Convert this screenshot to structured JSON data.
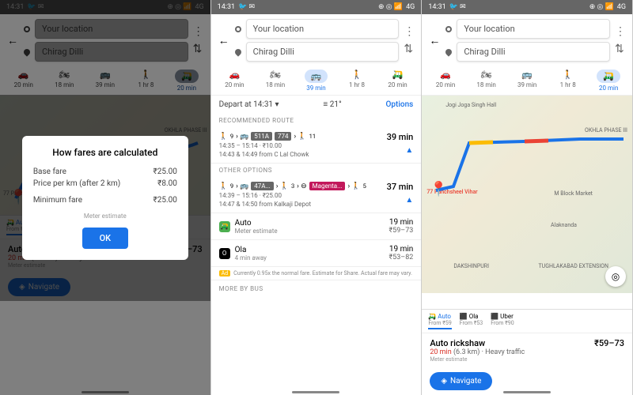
{
  "status": {
    "time": "14:31",
    "net": "4G"
  },
  "search": {
    "origin": "Your location",
    "dest": "Chirag Dilli"
  },
  "modes": {
    "car": "20 min",
    "bike": "18 min",
    "transit": "39 min",
    "walk": "1 hr 8",
    "taxi": "20 min"
  },
  "dialog": {
    "title": "How fares are calculated",
    "base_label": "Base fare",
    "base_val": "₹25.00",
    "km_label": "Price per km (after 2 km)",
    "km_val": "₹8.00",
    "min_label": "Minimum fare",
    "min_val": "₹25.00",
    "meter": "Meter estimate",
    "ok": "OK"
  },
  "transit": {
    "depart": "Depart at 14:31",
    "pref": "21°",
    "options": "Options",
    "rec_header": "RECOMMENDED ROUTE",
    "r1_badges": [
      "511A",
      "774"
    ],
    "r1_walk1": "9",
    "r1_walk2": "11",
    "r1_dur": "39 min",
    "r1_time": "14:35 – 15:14 · ₹10.00",
    "r1_from": "14:43 & 14:49 from C Lal Chowk",
    "other_header": "OTHER OPTIONS",
    "r2_b1": "47A...",
    "r2_b2": "Magenta...",
    "r2_w1": "9",
    "r2_w2": "3",
    "r2_w3": "5",
    "r2_dur": "37 min",
    "r2_time": "14:39 – 15:16 · ₹25.00",
    "r2_from": "14:47 & 14:50 from Kalkaji Depot",
    "auto_name": "Auto",
    "auto_sub": "Meter estimate",
    "auto_dur": "19 min",
    "auto_price": "₹59–73",
    "ola_name": "Ola",
    "ola_sub": "4 min away",
    "ola_dur": "19 min",
    "ola_price": "₹53–82",
    "ad": "Currently 0.95x the normal fare. Estimate for Share. Actual fare may vary.",
    "more": "MORE BY BUS"
  },
  "rides": {
    "tabs": [
      {
        "name": "Auto",
        "sub": "From ₹59"
      },
      {
        "name": "Ola",
        "sub": "From ₹53"
      },
      {
        "name": "Uber",
        "sub": "From ₹90"
      }
    ],
    "title": "Auto rickshaw",
    "time": "20 min",
    "dist": "(6.3 km)",
    "traffic": "Heavy traffic",
    "meter": "Meter estimate",
    "price": "₹59–73",
    "nav": "Navigate"
  },
  "map": {
    "labels": [
      "77 Panchsheel Vihar",
      "OKHLA PHASE III",
      "DAKSHINPURI",
      "TUGHLAKABAD EXTENSION",
      "M Block Market",
      "Alaknanda",
      "Jogi Joga Singh Hall"
    ]
  }
}
